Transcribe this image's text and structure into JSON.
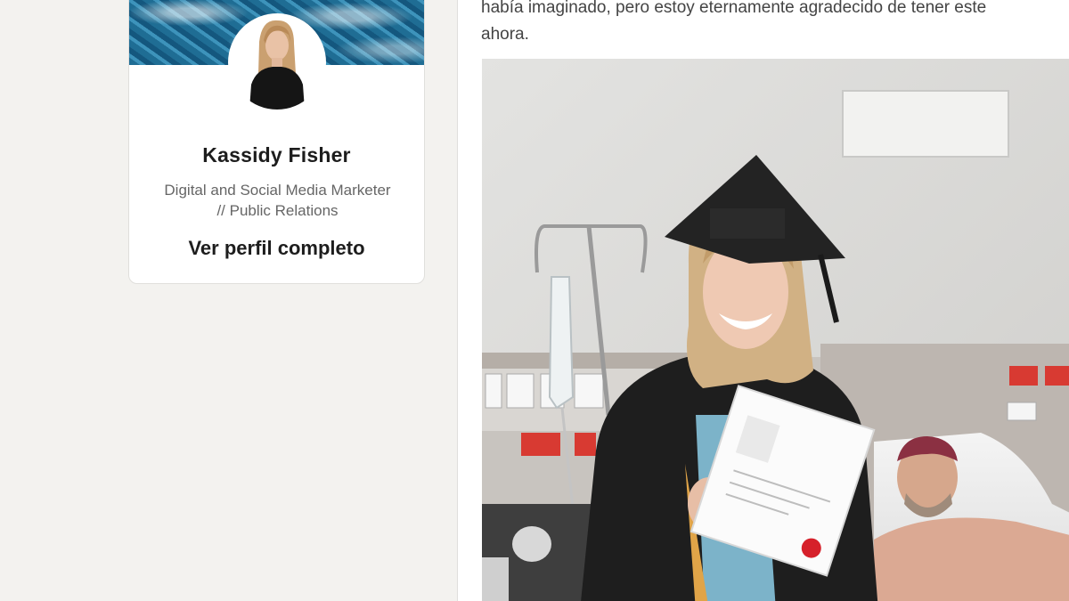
{
  "profile": {
    "name": "Kassidy Fisher",
    "headline_line1": "Digital and Social Media Marketer",
    "headline_line2": "// Public Relations",
    "view_profile_label": "Ver perfil completo"
  },
  "post": {
    "text_line1": "había imaginado, pero estoy eternamente agradecido de tener este",
    "text_line2": "ahora."
  },
  "colors": {
    "page_background": "#f3f2ef",
    "card_background": "#ffffff",
    "name_text": "#1d1d1d",
    "secondary_text": "#666666"
  }
}
